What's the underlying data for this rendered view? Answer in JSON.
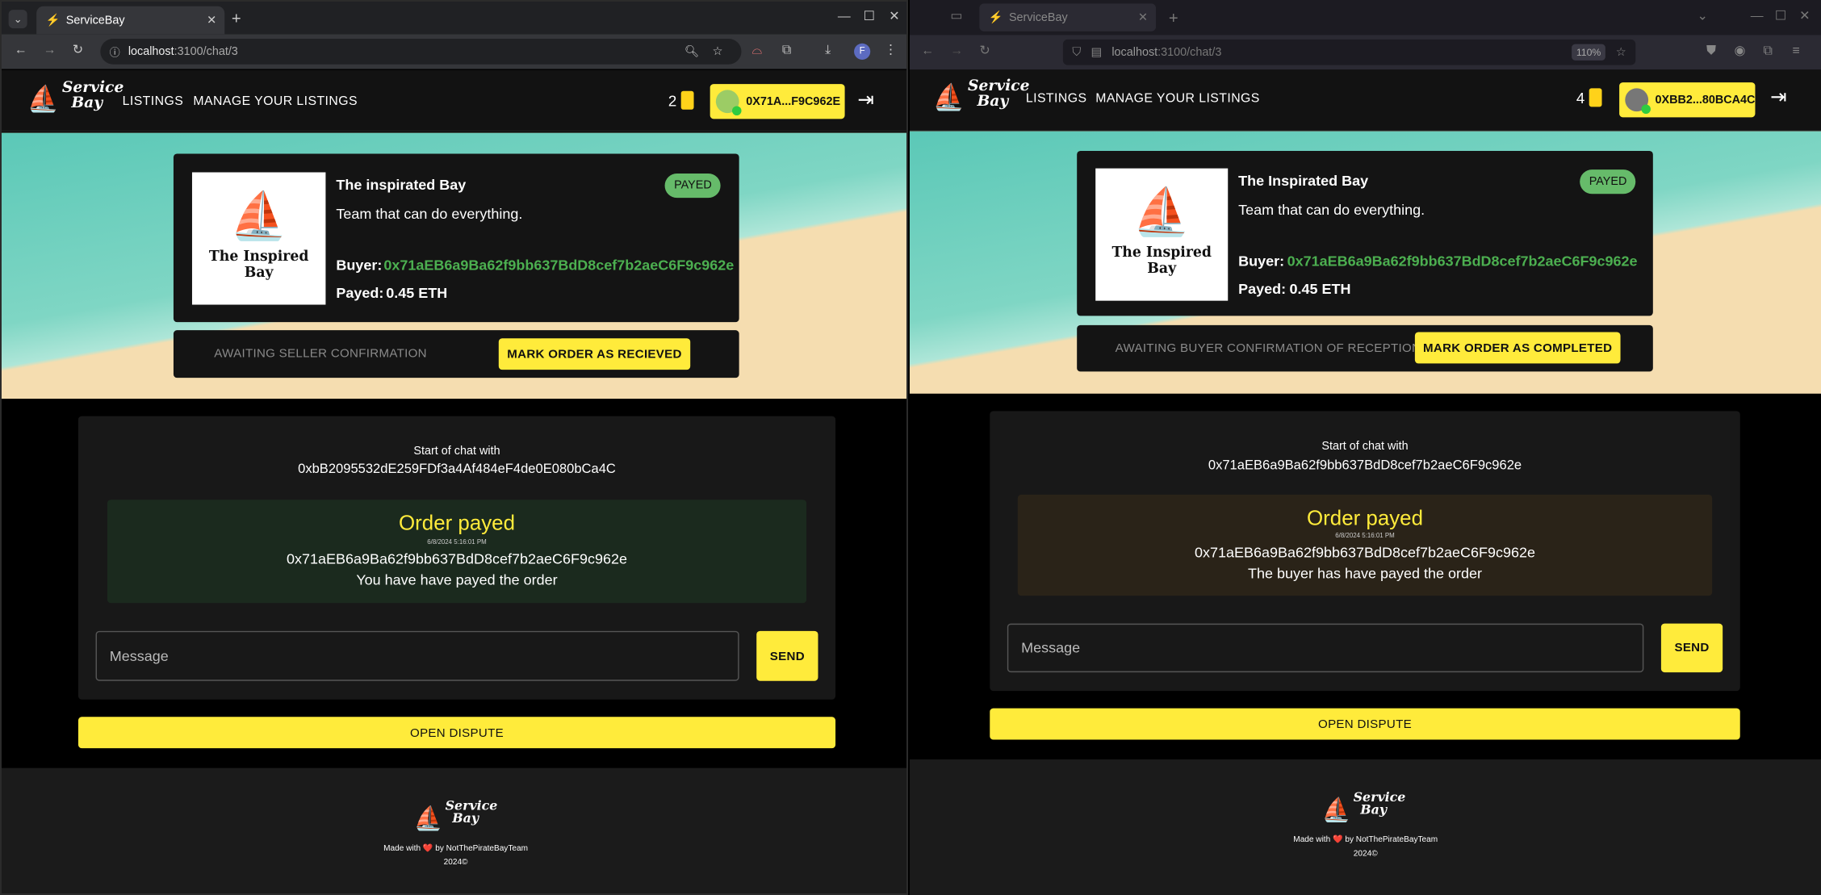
{
  "left": {
    "browser": {
      "tab_title": "ServiceBay",
      "url_host": "localhost",
      "url_path": ":3100/chat/3",
      "profile_initial": "F"
    },
    "app": {
      "nav": [
        "LISTINGS",
        "MANAGE YOUR LISTINGS"
      ],
      "logo_line1": "Service",
      "logo_line2": "Bay",
      "token_count": "2",
      "wallet_address": "0X71A...F9C962E",
      "listing": {
        "title": "The inspirated Bay",
        "description": "Team that can do everything.",
        "status_badge": "PAYED",
        "buyer_label": "Buyer:",
        "buyer_address": "0x71aEB6a9Ba62f9bb637BdD8cef7b2aeC6F9c962e",
        "payed_label": "Payed:",
        "payed_value": "0.45 ETH",
        "image_text_line1": "The Inspired",
        "image_text_line2": "Bay"
      },
      "status_text": "AWAITING SELLER CONFIRMATION",
      "action_button": "MARK ORDER AS RECIEVED",
      "chat": {
        "start_label": "Start of chat with",
        "start_address": "0xbB2095532dE259FDf3a4Af484eF4de0E080bCa4C",
        "message_title": "Order payed",
        "message_time": "6/8/2024 5:16:01 PM",
        "message_address": "0x71aEB6a9Ba62f9bb637BdD8cef7b2aeC6F9c962e",
        "message_text": "You have have payed the order",
        "input_placeholder": "Message",
        "send_label": "SEND"
      },
      "dispute_button": "OPEN DISPUTE",
      "footer": {
        "made_with": "Made with",
        "by_team": "by NotThePirateBayTeam",
        "year": "2024©"
      }
    }
  },
  "right": {
    "browser": {
      "tab_title": "ServiceBay",
      "url_host": "localhost",
      "url_path": ":3100/chat/3",
      "zoom": "110%"
    },
    "app": {
      "nav": [
        "LISTINGS",
        "MANAGE YOUR LISTINGS"
      ],
      "logo_line1": "Service",
      "logo_line2": "Bay",
      "token_count": "4",
      "wallet_address": "0XBB2...80BCA4C",
      "listing": {
        "title": "The Inspirated Bay",
        "description": "Team that can do everything.",
        "status_badge": "PAYED",
        "buyer_label": "Buyer:",
        "buyer_address": "0x71aEB6a9Ba62f9bb637BdD8cef7b2aeC6F9c962e",
        "payed_label": "Payed:",
        "payed_value": "0.45 ETH",
        "image_text_line1": "The Inspired",
        "image_text_line2": "Bay"
      },
      "status_text": "AWAITING BUYER CONFIRMATION OF RECEPTION",
      "action_button": "MARK ORDER AS COMPLETED",
      "chat": {
        "start_label": "Start of chat with",
        "start_address": "0x71aEB6a9Ba62f9bb637BdD8cef7b2aeC6F9c962e",
        "message_title": "Order payed",
        "message_time": "6/8/2024 5:16:01 PM",
        "message_address": "0x71aEB6a9Ba62f9bb637BdD8cef7b2aeC6F9c962e",
        "message_text": "The buyer has have payed the order",
        "input_placeholder": "Message",
        "send_label": "SEND"
      },
      "dispute_button": "OPEN DISPUTE",
      "footer": {
        "made_with": "Made with",
        "by_team": "by NotThePirateBayTeam",
        "year": "2024©"
      }
    }
  },
  "colors": {
    "accent_yellow": "#ffeb3b",
    "payed_green": "#66bb6a",
    "address_green": "#4caf50",
    "sender_msg_bg": "#1b2a1e",
    "receiver_msg_bg": "#2a2318"
  },
  "icons": [
    "lightning-icon",
    "back-icon",
    "forward-icon",
    "reload-icon",
    "info-icon",
    "zoom-icon",
    "star-icon",
    "extensions-icon",
    "download-icon",
    "menu-icon",
    "shield-icon",
    "lock-icon",
    "token-icon",
    "logout-icon",
    "heart-icon",
    "ship-icon"
  ]
}
